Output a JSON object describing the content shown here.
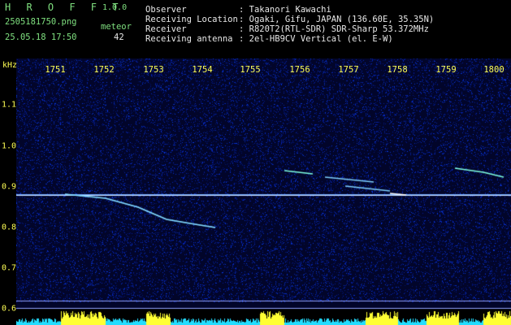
{
  "app": {
    "brand": "H R O F F T",
    "version": "1.0.0",
    "filename": "2505181750.png",
    "datetime": "25.05.18 17:50",
    "meteor_label": "meteor",
    "meteor_count": "42"
  },
  "info": {
    "observer_label": "Observer",
    "observer_value": ": Takanori Kawachi",
    "location_label": "Receiving Location",
    "location_value": ": Ogaki, Gifu, JAPAN (136.60E, 35.35N)",
    "receiver_label": "Receiver",
    "receiver_value": ": R820T2(RTL-SDR) SDR-Sharp 53.372MHz",
    "antenna_label": "Receiving antenna",
    "antenna_value": ": 2el-HB9CV Vertical (el. E-W)"
  },
  "axes": {
    "y_unit": "kHz",
    "x_ticks": [
      "1751",
      "1752",
      "1753",
      "1754",
      "1755",
      "1756",
      "1757",
      "1758",
      "1759",
      "1800"
    ],
    "y_ticks": [
      "1.1",
      "1.0",
      "0.9",
      "0.8",
      "0.7",
      "0.6"
    ]
  },
  "colors": {
    "background": "#000000",
    "noise": "#0a12a0",
    "trace": "#ffffff",
    "header_green": "#7fe07f",
    "header_white": "#e8e8e8",
    "axis_yellow": "#ffff55",
    "bottom_cyan": "#22ddff",
    "bottom_yellow": "#ffff33"
  }
}
